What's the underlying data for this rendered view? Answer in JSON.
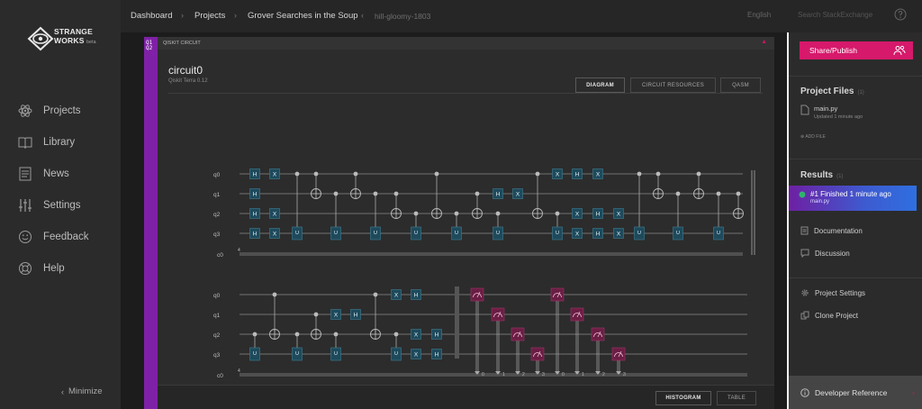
{
  "app": {
    "brand_line1": "STRANGE",
    "brand_line2": "WORKS",
    "brand_version": "beta"
  },
  "sidebar": {
    "items": [
      {
        "label": "Projects",
        "icon": "atom-icon"
      },
      {
        "label": "Library",
        "icon": "book-icon"
      },
      {
        "label": "News",
        "icon": "news-icon"
      },
      {
        "label": "Settings",
        "icon": "sliders-icon"
      },
      {
        "label": "Feedback",
        "icon": "smiley-icon"
      },
      {
        "label": "Help",
        "icon": "lifebuoy-icon"
      }
    ],
    "minimize_label": "Minimize"
  },
  "breadcrumb": {
    "items": [
      "Dashboard",
      "Projects",
      "Grover Searches in the Soup",
      "hill-gloomy-1803"
    ]
  },
  "topbar": {
    "language": "English",
    "search_placeholder": "Search StackExchange"
  },
  "card": {
    "badge": "Q1 Q2",
    "header_label": "QISKIT CIRCUIT",
    "circuit_name": "circuit0",
    "framework": "Qiskit Terra 0.12",
    "tabs": [
      {
        "label": "DIAGRAM",
        "active": true
      },
      {
        "label": "CIRCUIT RESOURCES",
        "active": false
      },
      {
        "label": "QASM",
        "active": false
      }
    ],
    "bottom_tabs": [
      {
        "label": "HISTOGRAM",
        "active": true
      },
      {
        "label": "TABLE",
        "active": false
      }
    ]
  },
  "circuit": {
    "qubits": [
      "q0",
      "q1",
      "q2",
      "q3"
    ],
    "classical": "c0",
    "classical_width": "4",
    "measure_bits": [
      "0",
      "1",
      "2",
      "3",
      "0",
      "1",
      "2",
      "3"
    ]
  },
  "right_panel": {
    "share_label": "Share/Publish",
    "project_files_title": "Project Files",
    "project_files_count": "(1)",
    "file_name": "main.py",
    "file_updated": "Updated 1 minute ago",
    "add_file_label": "ADD FILE",
    "results_title": "Results",
    "results_count": "(1)",
    "result_label": "#1 Finished 1 minute ago",
    "result_file": "main.py",
    "links": [
      "Documentation",
      "Discussion",
      "Project Settings",
      "Clone Project"
    ],
    "developer_reference": "Developer Reference"
  },
  "colors": {
    "accent": "#d6196b",
    "purple": "#7f21a6",
    "gate_fill": "#1e4a5c",
    "measure_fill": "#6b1e44"
  }
}
